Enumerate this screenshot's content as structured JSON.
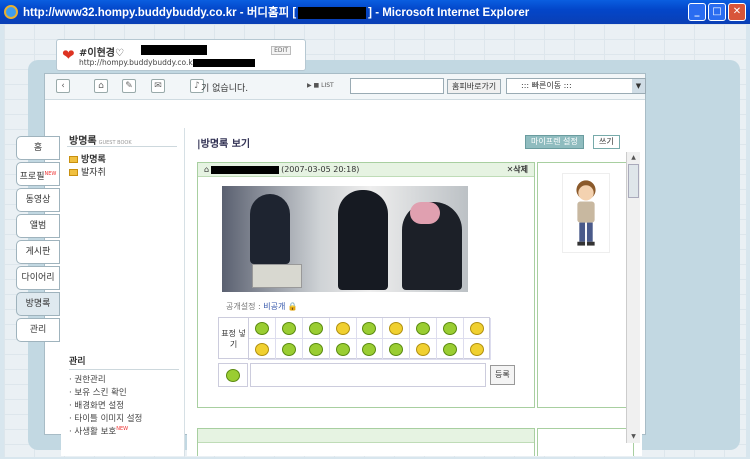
{
  "window": {
    "title_prefix": "http://www32.hompy.buddybuddy.co.kr - 버디홈피 [",
    "title_suffix": "] - Microsoft Internet Explorer",
    "min": "_",
    "max": "□",
    "close": "✕"
  },
  "profile": {
    "name": "#이현경♡",
    "edit": "EDIT",
    "url": "http://hompy.buddybuddy.co.kr/"
  },
  "toolbar": {
    "music": "기 없습니다.",
    "play": "▶ ■ LIST",
    "go_button": "홈피바로가기",
    "quick_move": "::: 빠른이동 :::"
  },
  "tabs": [
    {
      "label": "홈"
    },
    {
      "label": "프로필"
    },
    {
      "label": "동영상"
    },
    {
      "label": "앨범"
    },
    {
      "label": "게시판"
    },
    {
      "label": "다이어리"
    },
    {
      "label": "방명록"
    },
    {
      "label": "관리"
    }
  ],
  "sidebar": {
    "header": "방명록",
    "header_en": "GUEST BOOK",
    "folders": [
      "방명록",
      "발자취"
    ],
    "mgmt_title": "관리",
    "mgmt_items": [
      "· 권한관리",
      "· 보유 스킨 확인",
      "· 배경화면 설정",
      "· 타이틀 이미지 설정",
      "· 사생활 보호"
    ],
    "new_badge": "NEW"
  },
  "main": {
    "title": "|방명록 보기",
    "my_friend_btn": "마이프렌 설정",
    "write_btn": "쓰기",
    "post": {
      "date": "(2007-03-05 20:18)",
      "delete": "✕삭제",
      "privacy_label": "공개설정 :",
      "privacy_value": "비공개",
      "emotion_label": "표정 넣기",
      "register": "등록"
    }
  },
  "colors": {
    "titlebar": "#0346c9",
    "post_border": "#a8cfa0",
    "header_bg": "#e6f3e2",
    "teal_btn": "#8fbcbf"
  }
}
